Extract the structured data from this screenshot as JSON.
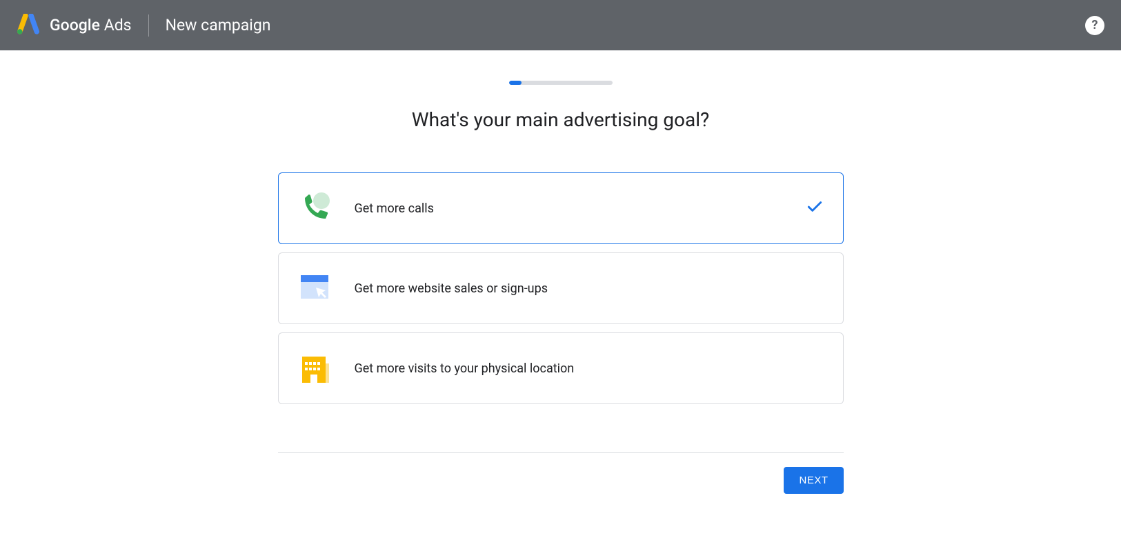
{
  "header": {
    "brand_prefix": "Google",
    "brand_suffix": " Ads",
    "page_title": "New campaign",
    "help_aria": "Help"
  },
  "progress": {
    "percent": 12
  },
  "main": {
    "question": "What's your main advertising goal?",
    "options": [
      {
        "id": "calls",
        "label": "Get more calls",
        "selected": true
      },
      {
        "id": "website",
        "label": "Get more website sales or sign-ups",
        "selected": false
      },
      {
        "id": "visits",
        "label": "Get more visits to your physical location",
        "selected": false
      }
    ],
    "next_label": "Next"
  }
}
